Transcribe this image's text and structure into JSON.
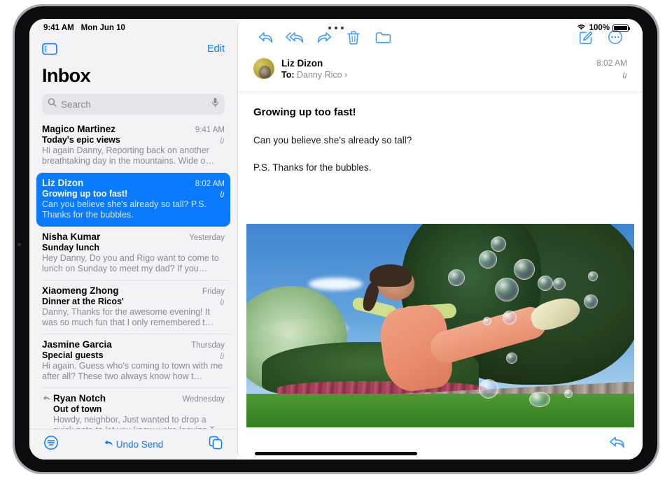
{
  "status_bar": {
    "time": "9:41 AM",
    "date": "Mon Jun 10",
    "battery_percent": "100%",
    "wifi_icon": "wifi-icon",
    "battery_icon": "battery-icon"
  },
  "sidebar": {
    "toggle_icon": "sidebar-toggle-icon",
    "edit_label": "Edit",
    "title": "Inbox",
    "search": {
      "placeholder": "Search",
      "search_icon": "search-icon",
      "mic_icon": "microphone-icon"
    },
    "messages": [
      {
        "sender": "Magico Martinez",
        "date": "9:41 AM",
        "subject": "Today's epic views",
        "preview": "Hi again Danny, Reporting back on another breathtaking day in the mountains. Wide o…",
        "has_attachment": true,
        "replied": false,
        "selected": false
      },
      {
        "sender": "Liz Dizon",
        "date": "8:02 AM",
        "subject": "Growing up too fast!",
        "preview": "Can you believe she's already so tall? P.S. Thanks for the bubbles.",
        "has_attachment": true,
        "replied": false,
        "selected": true
      },
      {
        "sender": "Nisha Kumar",
        "date": "Yesterday",
        "subject": "Sunday lunch",
        "preview": "Hey Danny, Do you and Rigo want to come to lunch on Sunday to meet my dad? If you…",
        "has_attachment": false,
        "replied": false,
        "selected": false
      },
      {
        "sender": "Xiaomeng Zhong",
        "date": "Friday",
        "subject": "Dinner at the Ricos'",
        "preview": "Danny, Thanks for the awesome evening! It was so much fun that I only remembered t…",
        "has_attachment": true,
        "replied": false,
        "selected": false
      },
      {
        "sender": "Jasmine Garcia",
        "date": "Thursday",
        "subject": "Special guests",
        "preview": "Hi again. Guess who's coming to town with me after all? These two always know how t…",
        "has_attachment": true,
        "replied": false,
        "selected": false
      },
      {
        "sender": "Ryan Notch",
        "date": "Wednesday",
        "subject": "Out of town",
        "preview": "Howdy, neighbor, Just wanted to drop a quick note to let you know we're leaving T…",
        "has_attachment": false,
        "replied": true,
        "selected": false
      }
    ],
    "bottom_bar": {
      "filter_icon": "filter-icon",
      "undo_send_label": "Undo Send",
      "undo_icon": "undo-arrow-icon",
      "multiselect_icon": "duplicate-icon"
    }
  },
  "reading_pane": {
    "toolbar": {
      "reply_icon": "reply-icon",
      "reply_all_icon": "reply-all-icon",
      "forward_icon": "forward-icon",
      "trash_icon": "trash-icon",
      "folder_icon": "folder-icon",
      "compose_icon": "compose-icon",
      "more_icon": "more-ellipsis-icon"
    },
    "message": {
      "avatar": "sender-avatar",
      "sender": "Liz Dizon",
      "to_label": "To:",
      "recipient": "Danny Rico",
      "disclosure": "›",
      "time": "8:02 AM",
      "attachment_icon": "paperclip-icon",
      "subject": "Growing up too fast!",
      "paragraphs": [
        "Can you believe she's already so tall?",
        "P.S. Thanks for the bubbles."
      ],
      "photo_alt": "girl-kicking-with-bubbles-photo"
    },
    "footer": {
      "reply_icon": "reply-icon"
    }
  },
  "colors": {
    "accent": "#007aff",
    "selected_row": "#0a7bff",
    "sidebar_background": "#f3f2f5",
    "secondary_text": "#8b8b90"
  }
}
